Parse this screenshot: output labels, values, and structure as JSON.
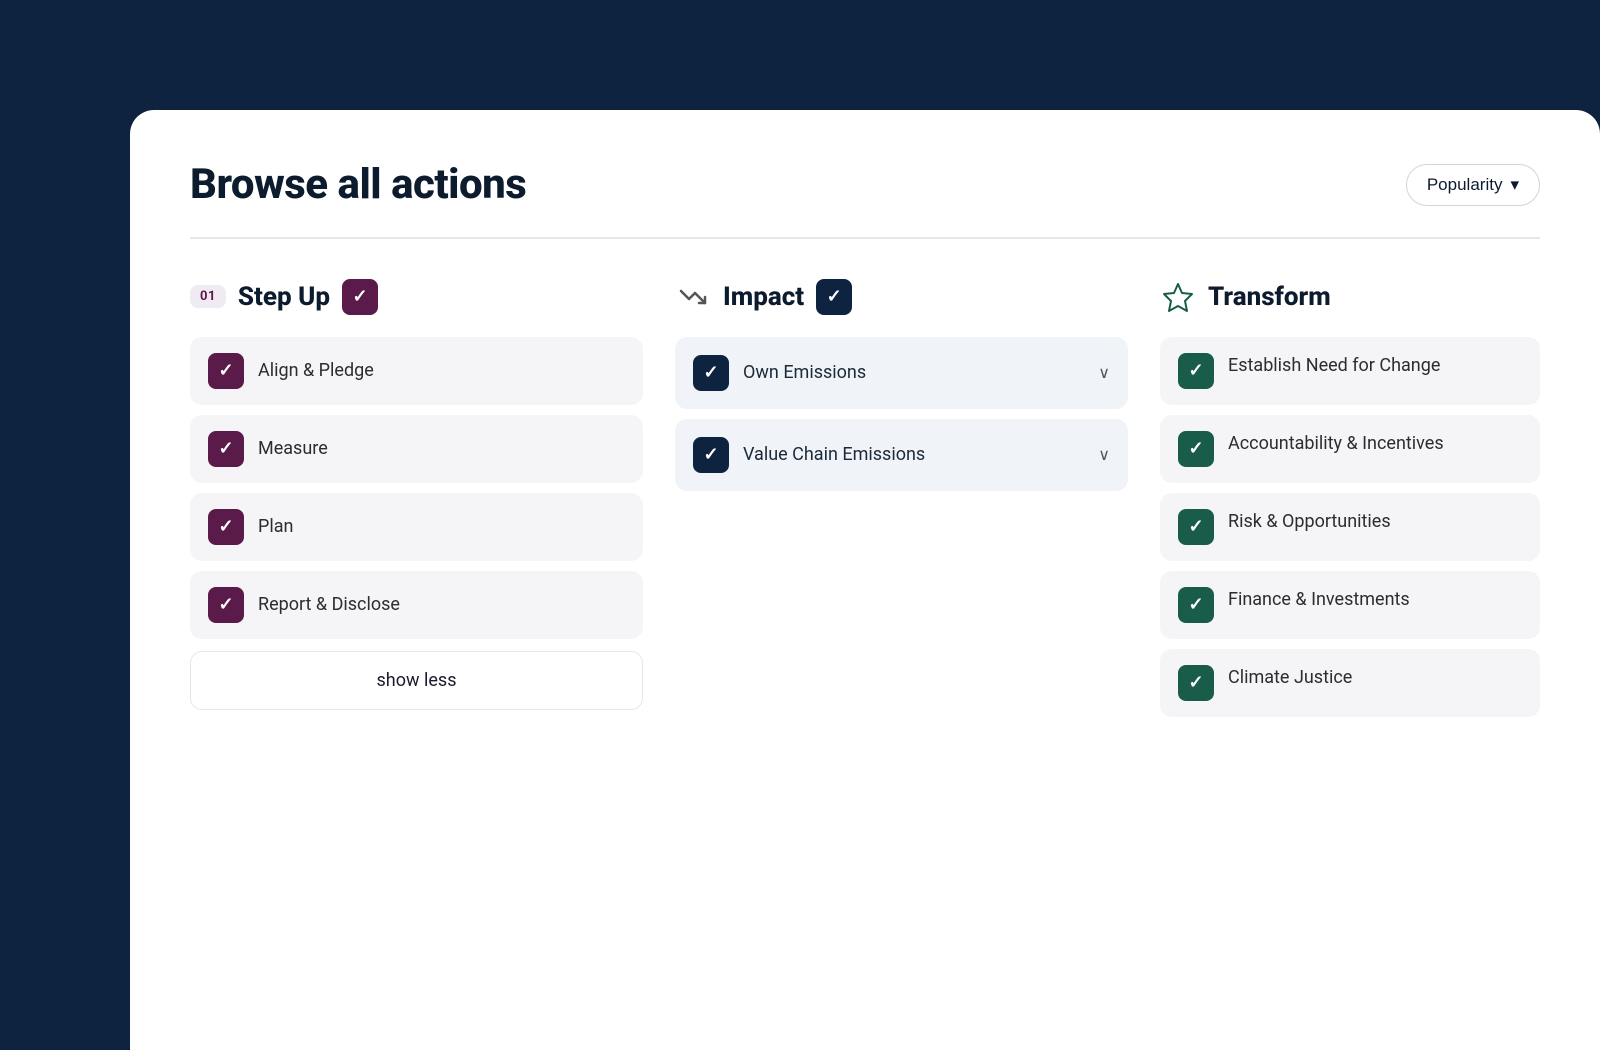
{
  "header": {
    "title": "Browse all actions",
    "sort_label": "Popularity",
    "sort_chevron": "▾"
  },
  "columns": [
    {
      "id": "step-up",
      "number": "01",
      "title": "Step Up",
      "checkbox_type": "checked-purple",
      "items": [
        {
          "label": "Align & Pledge",
          "type": "purple"
        },
        {
          "label": "Measure",
          "type": "purple"
        },
        {
          "label": "Plan",
          "type": "purple"
        },
        {
          "label": "Report & Disclose",
          "type": "purple"
        }
      ],
      "show_less_label": "show less"
    },
    {
      "id": "impact",
      "number": null,
      "title": "Impact",
      "icon": "trend-down",
      "checkbox_type": "checked-navy",
      "items": [
        {
          "label": "Own Emissions",
          "type": "navy",
          "has_chevron": true
        },
        {
          "label": "Value Chain Emissions",
          "type": "navy",
          "has_chevron": true
        }
      ]
    },
    {
      "id": "transform",
      "number": null,
      "title": "Transform",
      "icon": "star-outline",
      "items": [
        {
          "label": "Establish Need for Change",
          "type": "green"
        },
        {
          "label": "Accountability & Incentives",
          "type": "green"
        },
        {
          "label": "Risk & Opportunities",
          "type": "green"
        },
        {
          "label": "Finance & Investments",
          "type": "green"
        },
        {
          "label": "Climate Justice",
          "type": "green"
        }
      ]
    }
  ]
}
